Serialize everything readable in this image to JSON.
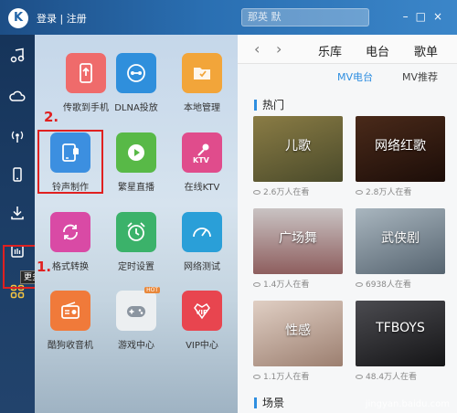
{
  "header": {
    "logo": "K",
    "login": "登录 | 注册",
    "search_placeholder": "那英 默"
  },
  "sidebar": {
    "more_tooltip": "更多"
  },
  "apps": [
    {
      "label": "传歌到手机",
      "icon": "phone-transfer-icon",
      "color": "#ef6b6b"
    },
    {
      "label": "DLNA投放",
      "icon": "dlna-icon",
      "color": "#2f8fdc"
    },
    {
      "label": "本地管理",
      "icon": "folder-icon",
      "color": "#f2a53a"
    },
    {
      "label": "铃声制作",
      "icon": "ringtone-icon",
      "color": "#3c8fe0"
    },
    {
      "label": "繁星直播",
      "icon": "live-icon",
      "color": "#58b947"
    },
    {
      "label": "在线KTV",
      "icon": "ktv-icon",
      "color": "#e04c8c"
    },
    {
      "label": "格式转换",
      "icon": "convert-icon",
      "color": "#d94aa5"
    },
    {
      "label": "定时设置",
      "icon": "alarm-icon",
      "color": "#3bb26a"
    },
    {
      "label": "网络测试",
      "icon": "speedometer-icon",
      "color": "#2a9fd8"
    },
    {
      "label": "酷狗收音机",
      "icon": "radio-icon",
      "color": "#f07a3a"
    },
    {
      "label": "游戏中心",
      "icon": "gamepad-icon",
      "color": "#eceff1",
      "badge": "HOT"
    },
    {
      "label": "VIP中心",
      "icon": "vip-icon",
      "color": "#e8454f"
    }
  ],
  "annotations": {
    "one": "1.",
    "two": "2."
  },
  "panel": {
    "tabs": [
      "乐库",
      "电台",
      "歌单"
    ],
    "subtabs": [
      "MV电台",
      "MV推荐"
    ],
    "sections": {
      "hot": "热门",
      "scene": "场景"
    },
    "mvs": [
      {
        "title": "儿歌",
        "views": "2.6万人在看",
        "bg": "#6f6a3a"
      },
      {
        "title": "网络红歌",
        "views": "2.8万人在看",
        "bg": "#3a1f14"
      },
      {
        "title": "广场舞",
        "views": "1.4万人在看",
        "bg": "#9a8a8a"
      },
      {
        "title": "武侠剧",
        "views": "6938人在看",
        "bg": "#7d8b96"
      },
      {
        "title": "性感",
        "views": "1.1万人在看",
        "bg": "#c9b2a4"
      },
      {
        "title": "TFBOYS",
        "views": "48.4万人在看",
        "bg": "#2d2d30"
      }
    ],
    "watermark": "jingyan.baidu.com"
  }
}
